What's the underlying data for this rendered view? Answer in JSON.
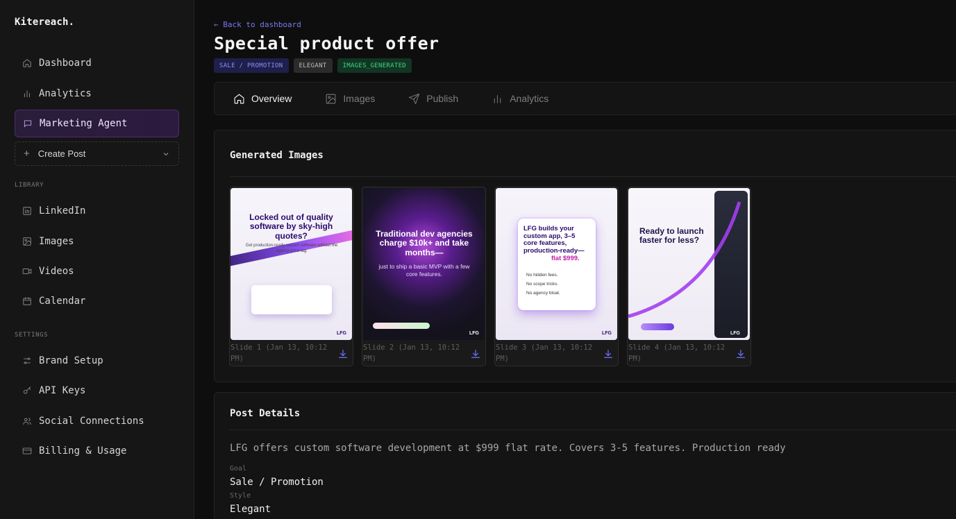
{
  "brand": "Kitereach.",
  "sidebar": {
    "nav": [
      {
        "label": "Dashboard",
        "icon": "home-icon"
      },
      {
        "label": "Analytics",
        "icon": "bar-chart-icon"
      },
      {
        "label": "Marketing Agent",
        "icon": "chat-icon"
      }
    ],
    "create_post": "Create Post",
    "library_label": "LIBRARY",
    "library": [
      {
        "label": "LinkedIn",
        "icon": "linkedin-icon"
      },
      {
        "label": "Images",
        "icon": "image-icon"
      },
      {
        "label": "Videos",
        "icon": "video-icon"
      },
      {
        "label": "Calendar",
        "icon": "calendar-icon"
      }
    ],
    "settings_label": "SETTINGS",
    "settings": [
      {
        "label": "Brand Setup",
        "icon": "sliders-icon"
      },
      {
        "label": "API Keys",
        "icon": "key-icon"
      },
      {
        "label": "Social Connections",
        "icon": "users-icon"
      },
      {
        "label": "Billing & Usage",
        "icon": "credit-card-icon"
      }
    ]
  },
  "header": {
    "back": "← Back to dashboard",
    "title": "Special product offer",
    "badges": [
      "SALE / PROMOTION",
      "ELEGANT",
      "IMAGES_GENERATED"
    ]
  },
  "tabs": [
    {
      "label": "Overview",
      "icon": "home-icon"
    },
    {
      "label": "Images",
      "icon": "image-icon"
    },
    {
      "label": "Publish",
      "icon": "send-icon"
    },
    {
      "label": "Analytics",
      "icon": "bar-chart-icon"
    }
  ],
  "generated": {
    "title": "Generated Images",
    "slides": [
      {
        "caption": "Slide 1 (Jan 13, 10:12 PM)",
        "headline": "Locked out of quality software by sky-high quotes?",
        "sub": "Get production-ready custom software without the agency price tag.",
        "logo": "LFG"
      },
      {
        "caption": "Slide 2 (Jan 13, 10:12 PM)",
        "headline": "Traditional dev agencies charge $10k+ and take months—",
        "sub": "just to ship a basic MVP with a few core features.",
        "logo": "LFG"
      },
      {
        "caption": "Slide 3 (Jan 13, 10:12 PM)",
        "headline": "LFG builds your custom app, 3–5 core features, production-ready—",
        "price": "flat $999.",
        "bullets": [
          "No hidden fees.",
          "No scope tricks.",
          "No agency bloat."
        ],
        "logo": "LFG"
      },
      {
        "caption": "Slide 4 (Jan 13, 10:12 PM)",
        "headline": "Ready to launch faster for less?",
        "logo": "LFG"
      }
    ]
  },
  "details": {
    "title": "Post Details",
    "description": "LFG offers custom software development at $999 flat rate. Covers 3-5 features. Production ready",
    "goal_label": "Goal",
    "goal": "Sale / Promotion",
    "style_label": "Style",
    "style": "Elegant"
  },
  "colors": {
    "accent": "#7b77f0",
    "success": "#3fd97f",
    "active_bg": "#2a1d3a"
  }
}
